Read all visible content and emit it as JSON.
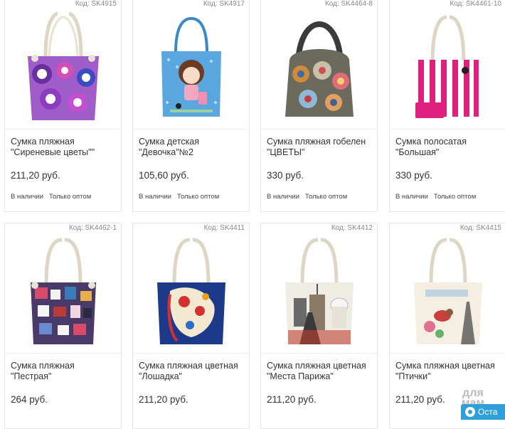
{
  "products": [
    {
      "code": "Код: SK4915",
      "name_line1": "Сумка пляжная",
      "name_line2": "\"Сиреневые цветы\"\"",
      "price": "211,20 руб.",
      "avail": "В наличии",
      "wholesale": "Только оптом",
      "icon": "bag-purple-circles-icon"
    },
    {
      "code": "Код: SK4917",
      "name_line1": "Сумка детская",
      "name_line2": "\"Девочка\"№2",
      "price": "105,60 руб.",
      "avail": "В наличии",
      "wholesale": "Только оптом",
      "icon": "bag-blue-girl-icon"
    },
    {
      "code": "Код: SK4464-8",
      "name_line1": "Сумка пляжная гобелен",
      "name_line2": "\"ЦВЕТЫ\"",
      "price": "330 руб.",
      "avail": "В наличии",
      "wholesale": "Только оптом",
      "icon": "bag-tapestry-flowers-icon"
    },
    {
      "code": "Код: SK4461-10",
      "name_line1": "Сумка полосатая",
      "name_line2": "\"Большая\"",
      "price": "330 руб.",
      "avail": "В наличии",
      "wholesale": "Только оптом",
      "icon": "bag-pink-stripes-icon"
    },
    {
      "code": "Код: SK4462-1",
      "name_line1": "Сумка пляжная \"Пестрая\"",
      "name_line2": "",
      "price": "264 руб.",
      "icon": "bag-motley-icon"
    },
    {
      "code": "Код: SK4411",
      "name_line1": "Сумка пляжная цветная",
      "name_line2": "\"Лошадка\"",
      "price": "211,20 руб.",
      "icon": "bag-horse-icon"
    },
    {
      "code": "Код: SK4412",
      "name_line1": "Сумка пляжная цветная",
      "name_line2": "\"Места Парижа\"",
      "price": "211,20 руб.",
      "icon": "bag-paris-icon"
    },
    {
      "code": "Код: SK4415",
      "name_line1": "Сумка пляжная цветная",
      "name_line2": "\"Птички\"",
      "price": "211,20 руб.",
      "icon": "bag-birds-icon"
    }
  ],
  "watermark": {
    "logo": "для мам",
    "button": "Оста"
  },
  "colors": {
    "border": "#e6e6e6",
    "text": "#333333",
    "muted": "#888888",
    "accent": "#2e9fd8"
  }
}
